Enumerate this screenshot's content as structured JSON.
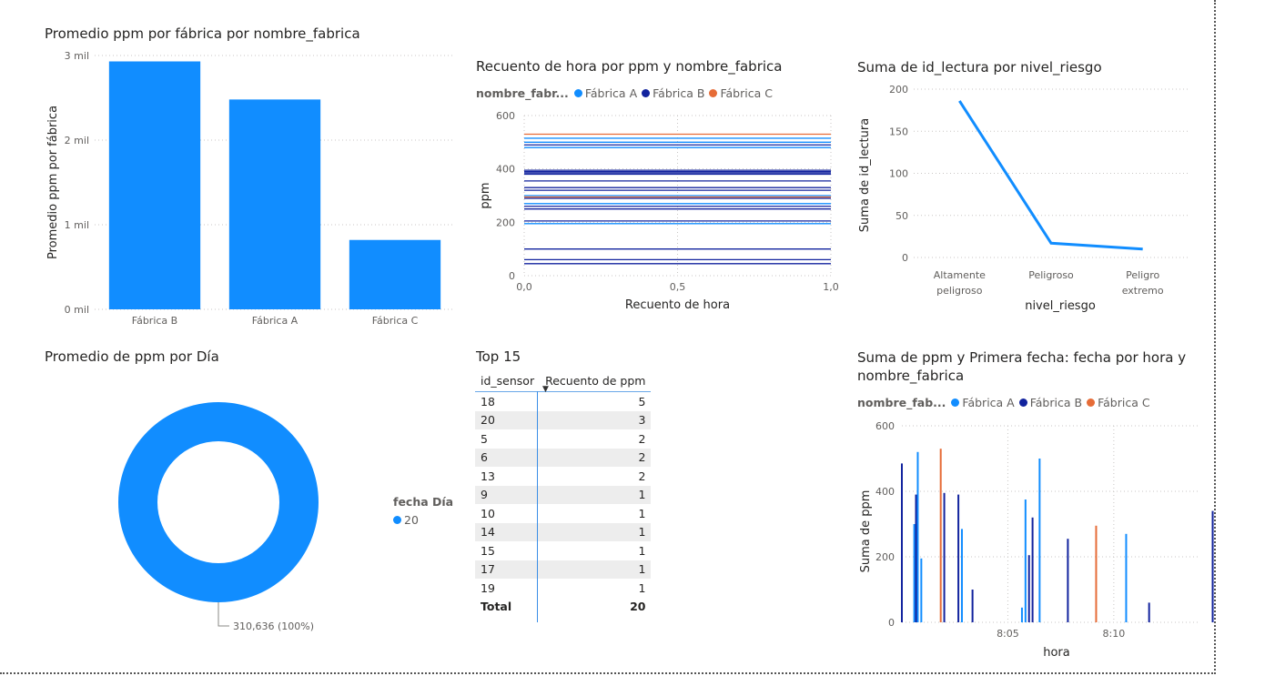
{
  "colors": {
    "a": "#118dff",
    "b": "#12239e",
    "c": "#e66c37",
    "grid": "#c8c6c4"
  },
  "visual1": {
    "title": "Promedio ppm por fábrica por nombre_fabrica"
  },
  "visual2": {
    "title": "Recuento de hora por ppm y nombre_fabrica",
    "legend_title": "nombre_fabr..."
  },
  "visual3": {
    "title": "Suma de id_lectura por nivel_riesgo"
  },
  "visual4": {
    "title": "Promedio de ppm por Día",
    "legend_title": "fecha Día"
  },
  "visual5": {
    "title": "Top 15",
    "columns": [
      "id_sensor",
      "Recuento de ppm"
    ],
    "rows": [
      [
        "18",
        "5"
      ],
      [
        "20",
        "3"
      ],
      [
        "5",
        "2"
      ],
      [
        "6",
        "2"
      ],
      [
        "13",
        "2"
      ],
      [
        "9",
        "1"
      ],
      [
        "10",
        "1"
      ],
      [
        "14",
        "1"
      ],
      [
        "15",
        "1"
      ],
      [
        "17",
        "1"
      ],
      [
        "19",
        "1"
      ]
    ],
    "total_label": "Total",
    "total_value": "20"
  },
  "visual6": {
    "title_line1": "Suma de ppm y Primera fecha: fecha por hora y",
    "title_line2": "nombre_fabrica",
    "legend_title": "nombre_fab..."
  },
  "chart_data": [
    {
      "type": "bar",
      "title": "Promedio ppm por fábrica por nombre_fabrica",
      "xlabel": "",
      "ylabel": "Promedio ppm por fábrica",
      "categories": [
        "Fábrica B",
        "Fábrica A",
        "Fábrica C"
      ],
      "values": [
        2930,
        2480,
        820
      ],
      "ylim": [
        0,
        3000
      ],
      "yticks": [
        0,
        1000,
        2000,
        3000
      ],
      "ytick_labels": [
        "0 mil",
        "1 mil",
        "2 mil",
        "3 mil"
      ],
      "grid": true
    },
    {
      "type": "line",
      "title": "Recuento de hora por ppm y nombre_fabrica",
      "xlabel": "Recuento de hora",
      "ylabel": "ppm",
      "xlim": [
        0,
        1
      ],
      "ylim": [
        0,
        600
      ],
      "xticks": [
        0,
        0.5,
        1
      ],
      "xtick_labels": [
        "0,0",
        "0,5",
        "1,0"
      ],
      "yticks": [
        0,
        200,
        400,
        600
      ],
      "ytick_labels": [
        "0",
        "200",
        "400",
        "600"
      ],
      "series": [
        {
          "name": "Fábrica A",
          "values": [
            515,
            500,
            480,
            300,
            270,
            195
          ]
        },
        {
          "name": "Fábrica B",
          "values": [
            490,
            395,
            390,
            385,
            380,
            355,
            330,
            320,
            290,
            260,
            250,
            205,
            100,
            60,
            45
          ]
        },
        {
          "name": "Fábrica C",
          "values": [
            530,
            295
          ]
        }
      ],
      "legend": "top-left",
      "grid": true
    },
    {
      "type": "line",
      "title": "Suma de id_lectura por nivel_riesgo",
      "xlabel": "nivel_riesgo",
      "ylabel": "Suma de id_lectura",
      "categories": [
        "Altamente peligroso",
        "Peligroso",
        "Peligro extremo"
      ],
      "values": [
        186,
        17,
        10
      ],
      "ylim": [
        0,
        200
      ],
      "yticks": [
        0,
        50,
        100,
        150,
        200
      ],
      "grid": true
    },
    {
      "type": "pie",
      "title": "Promedio de ppm por Día",
      "categories": [
        "20"
      ],
      "values": [
        310636
      ],
      "labels": [
        "310,636 (100%)"
      ],
      "donut": true,
      "legend": "right"
    },
    {
      "type": "table",
      "title": "Top 15",
      "columns": [
        "id_sensor",
        "Recuento de ppm"
      ],
      "rows": [
        [
          "18",
          5
        ],
        [
          "20",
          3
        ],
        [
          "5",
          2
        ],
        [
          "6",
          2
        ],
        [
          "13",
          2
        ],
        [
          "9",
          1
        ],
        [
          "10",
          1
        ],
        [
          "14",
          1
        ],
        [
          "15",
          1
        ],
        [
          "17",
          1
        ],
        [
          "19",
          1
        ]
      ],
      "total": 20
    },
    {
      "type": "bar",
      "title": "Suma de ppm y Primera fecha: fecha por hora y nombre_fabrica",
      "xlabel": "hora",
      "ylabel": "Suma de ppm",
      "xlim": [
        "8:00",
        "8:14"
      ],
      "xtick_labels": [
        "8:05",
        "8:10"
      ],
      "ylim": [
        0,
        600
      ],
      "yticks": [
        0,
        200,
        400,
        600
      ],
      "series": [
        {
          "name": "Fábrica A",
          "points": [
            [
              "8:00:35",
              300
            ],
            [
              "8:00:45",
              520
            ],
            [
              "8:00:55",
              195
            ],
            [
              "8:02:50",
              285
            ],
            [
              "8:05:40",
              45
            ],
            [
              "8:05:50",
              375
            ],
            [
              "8:06:30",
              500
            ],
            [
              "8:10:35",
              270
            ]
          ]
        },
        {
          "name": "Fábrica B",
          "points": [
            [
              "8:00:00",
              485
            ],
            [
              "8:00:40",
              390
            ],
            [
              "8:02:00",
              395
            ],
            [
              "8:02:40",
              390
            ],
            [
              "8:03:20",
              100
            ],
            [
              "8:06:00",
              205
            ],
            [
              "8:06:10",
              320
            ],
            [
              "8:07:50",
              255
            ],
            [
              "8:11:40",
              60
            ],
            [
              "8:14:40",
              340
            ]
          ]
        },
        {
          "name": "Fábrica C",
          "points": [
            [
              "8:01:50",
              530
            ],
            [
              "8:09:10",
              295
            ]
          ]
        }
      ],
      "legend": "top-left",
      "grid": true
    }
  ]
}
